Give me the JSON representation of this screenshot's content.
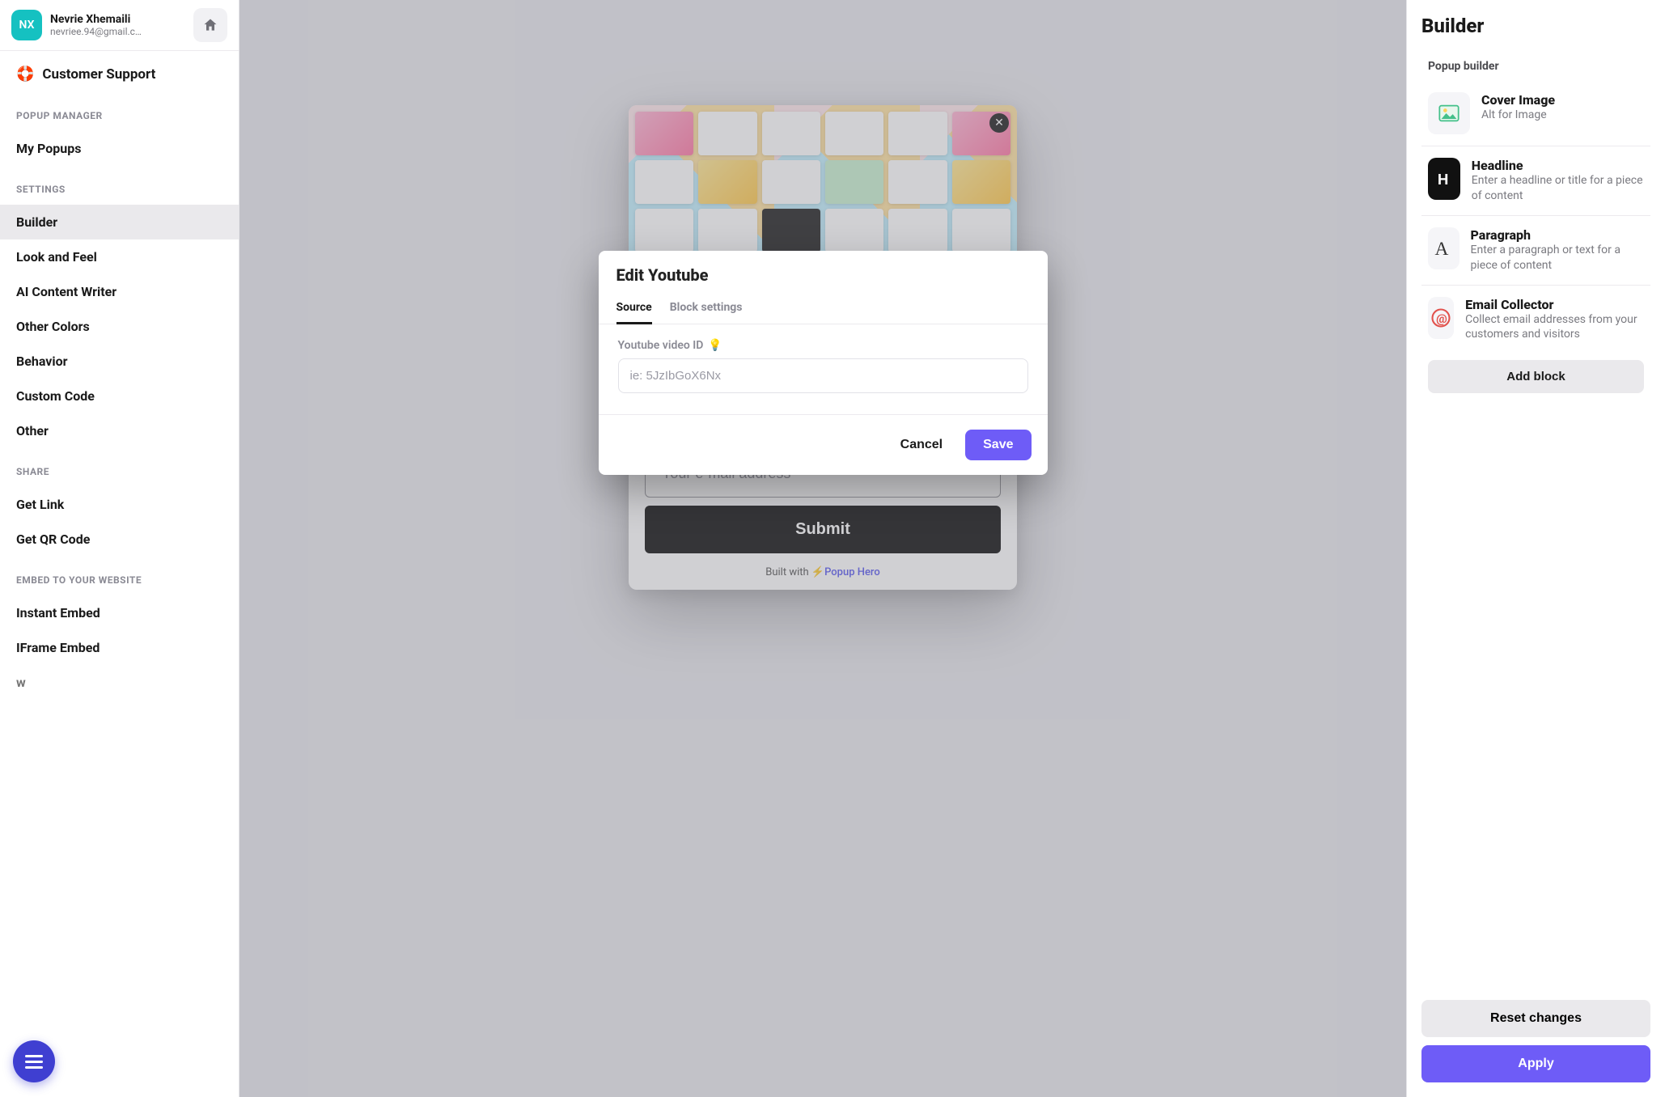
{
  "user": {
    "initials": "NX",
    "name": "Nevrie Xhemaili",
    "email": "nevriee.94@gmail.c…"
  },
  "sidebar": {
    "support_label": "Customer Support",
    "sections": {
      "popup_manager": "POPUP MANAGER",
      "settings": "SETTINGS",
      "share": "SHARE",
      "embed": "EMBED TO YOUR WEBSITE"
    },
    "items": {
      "my_popups": "My Popups",
      "builder": "Builder",
      "look_and_feel": "Look and Feel",
      "ai_writer": "AI Content Writer",
      "other_colors": "Other Colors",
      "behavior": "Behavior",
      "custom_code": "Custom Code",
      "other": "Other",
      "get_link": "Get Link",
      "get_qr": "Get QR Code",
      "instant_embed": "Instant Embed",
      "iframe_embed": "IFrame Embed",
      "truncated": "w"
    }
  },
  "preview": {
    "email_placeholder": "Your e-mail address",
    "submit_label": "Submit",
    "built_with_prefix": "Built with ",
    "built_with_link": "Popup Hero"
  },
  "modal": {
    "title": "Edit Youtube",
    "tabs": {
      "source": "Source",
      "block_settings": "Block settings"
    },
    "field_label": "Youtube video ID",
    "field_hint_icon": "💡",
    "field_placeholder": "ie: 5JzIbGoX6Nx",
    "cancel": "Cancel",
    "save": "Save"
  },
  "right": {
    "title": "Builder",
    "subtitle": "Popup builder",
    "blocks": [
      {
        "name": "Cover Image",
        "desc": "Alt for Image",
        "icon": "image"
      },
      {
        "name": "Headline",
        "desc": "Enter a headline or title for a piece of content",
        "icon": "headline"
      },
      {
        "name": "Paragraph",
        "desc": "Enter a paragraph or text for a piece of content",
        "icon": "paragraph"
      },
      {
        "name": "Email Collector",
        "desc": "Collect email addresses from your customers and visitors",
        "icon": "email"
      }
    ],
    "add_block": "Add block",
    "reset": "Reset changes",
    "apply": "Apply"
  }
}
